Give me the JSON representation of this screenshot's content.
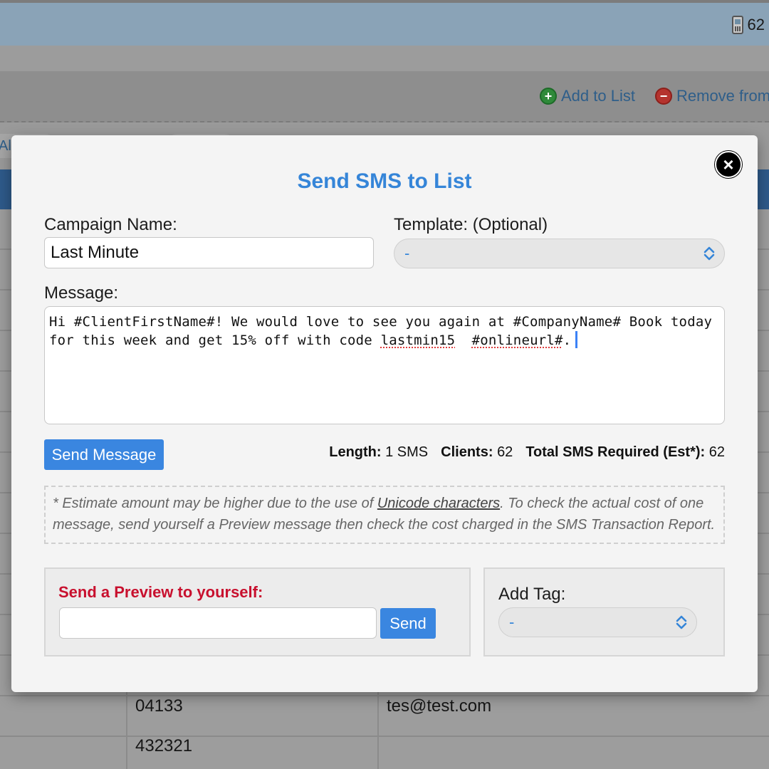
{
  "background": {
    "sms_credits": "62",
    "add_to_list": "Add to List",
    "remove_from": "Remove from",
    "filter_all": "All",
    "rows": [
      {
        "phone": "04133",
        "email": "tes@test.com"
      },
      {
        "phone": "432321",
        "email": ""
      }
    ]
  },
  "modal": {
    "title": "Send SMS to List",
    "close": "×",
    "campaign_label": "Campaign Name:",
    "campaign_value": "Last Minute",
    "template_label": "Template: (Optional)",
    "template_value": "-",
    "message_label": "Message:",
    "message_part1": "Hi #ClientFirstName#! We would love to see you again at #CompanyName# Book today for this week and get 15% off with code ",
    "message_code": "lastmin15",
    "message_part2": "  ",
    "message_url": "#onlineurl#",
    "message_part3": ".",
    "send_button": "Send Message",
    "length_label": "Length:",
    "length_value": "1 SMS",
    "clients_label": "Clients:",
    "clients_value": "62",
    "total_label": "Total SMS Required (Est*):",
    "total_value": "62",
    "note_part1": "* Estimate amount may be higher due to the use of ",
    "note_link": "Unicode characters",
    "note_part2": ". To check the actual cost of one message, send yourself a Preview message then check the cost charged in the SMS Transaction Report.",
    "preview_title": "Send a Preview to yourself:",
    "preview_value": "",
    "preview_send": "Send",
    "tag_label": "Add Tag:",
    "tag_value": "-"
  },
  "colors": {
    "accent": "#3a86e0",
    "title_blue": "#3585d8",
    "preview_red": "#c8102e"
  }
}
